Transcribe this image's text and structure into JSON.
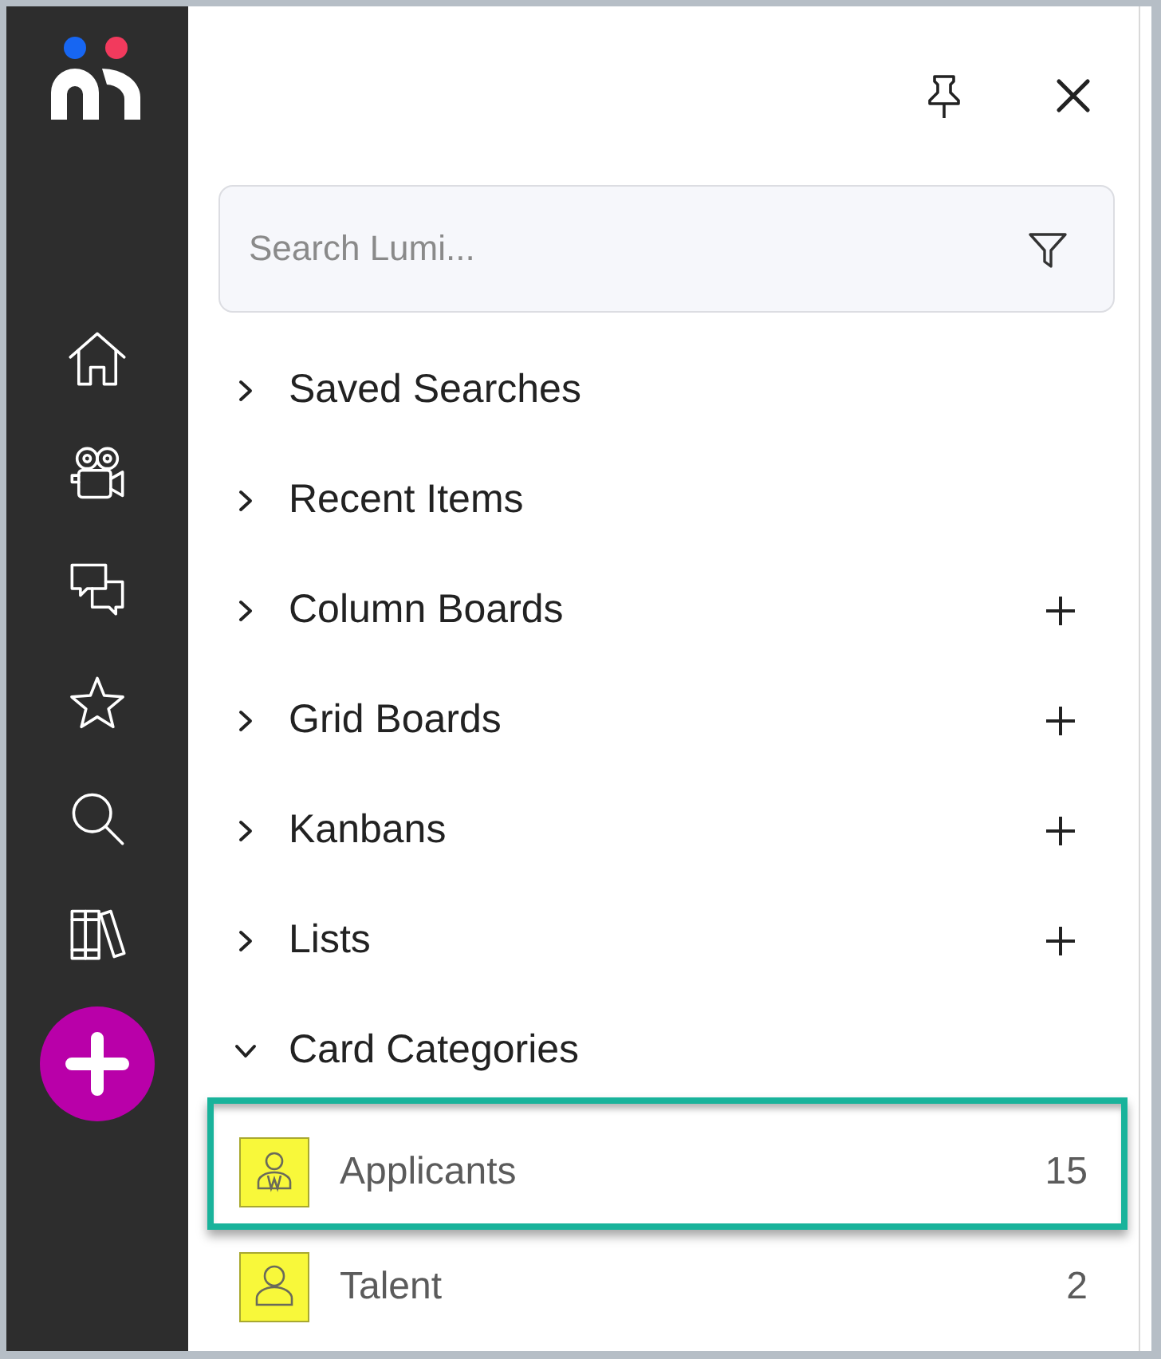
{
  "search": {
    "placeholder": "Search Lumi..."
  },
  "sections": [
    {
      "label": "Saved Searches",
      "expanded": false,
      "add": false
    },
    {
      "label": "Recent Items",
      "expanded": false,
      "add": false
    },
    {
      "label": "Column Boards",
      "expanded": false,
      "add": true
    },
    {
      "label": "Grid Boards",
      "expanded": false,
      "add": true
    },
    {
      "label": "Kanbans",
      "expanded": false,
      "add": true
    },
    {
      "label": "Lists",
      "expanded": false,
      "add": true
    },
    {
      "label": "Card Categories",
      "expanded": true,
      "add": false,
      "children": [
        {
          "label": "Applicants",
          "count": "15",
          "kind": "suited",
          "selected": true
        },
        {
          "label": "Talent",
          "count": "2",
          "kind": "plain",
          "selected": false
        }
      ]
    }
  ]
}
